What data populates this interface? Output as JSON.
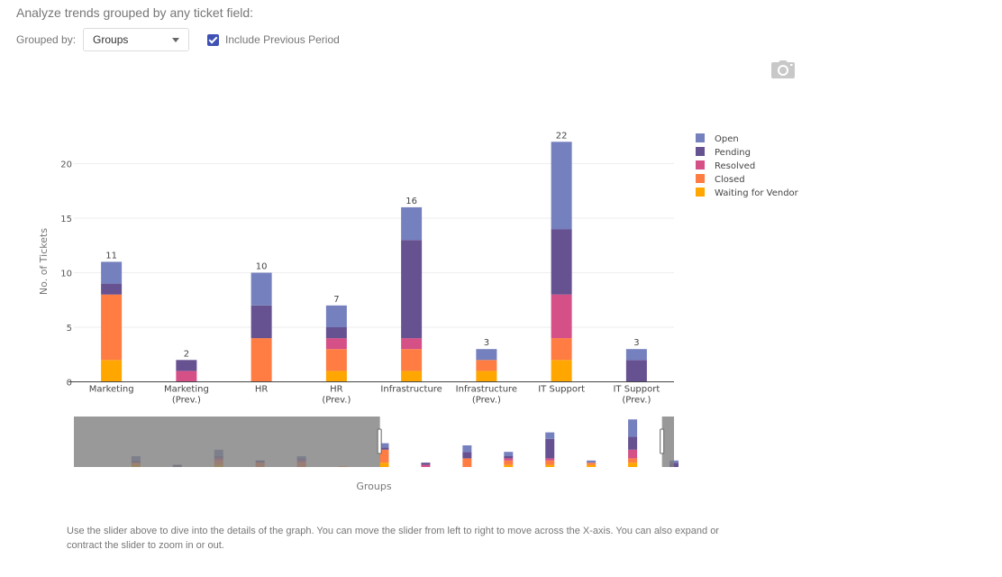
{
  "header": {
    "intro": "Analyze trends grouped by any ticket field:",
    "grouped_by_label": "Grouped by:",
    "grouped_by_value": "Groups",
    "include_previous_label": "Include Previous Period",
    "include_previous_checked": true
  },
  "toolbar": {
    "camera_icon": "camera-icon"
  },
  "note": "Use the slider above to dive into the details of the graph. You can move the slider from left to right to move across the X-axis. You can also expand or contract the slider to zoom in or out.",
  "chart_data": {
    "type": "bar",
    "stacked": true,
    "title": "",
    "xlabel": "Groups",
    "ylabel": "No. of Tickets",
    "ylim": [
      0,
      23
    ],
    "yticks": [
      0,
      5,
      10,
      15,
      20
    ],
    "grid": true,
    "legend_position": "top-right",
    "categories": [
      "Marketing",
      "Marketing (Prev.)",
      "HR",
      "HR (Prev.)",
      "Infrastructure",
      "Infrastructure (Prev.)",
      "IT Support",
      "IT Support (Prev.)"
    ],
    "category_lines": [
      [
        "Marketing"
      ],
      [
        "Marketing",
        "(Prev.)"
      ],
      [
        "HR"
      ],
      [
        "HR",
        "(Prev.)"
      ],
      [
        "Infrastructure"
      ],
      [
        "Infrastructure",
        "(Prev.)"
      ],
      [
        "IT Support"
      ],
      [
        "IT Support",
        "(Prev.)"
      ]
    ],
    "series": [
      {
        "name": "Waiting for Vendor",
        "color": "#ffa600",
        "values": [
          2,
          0,
          0,
          1,
          1,
          1,
          2,
          0
        ]
      },
      {
        "name": "Closed",
        "color": "#ff7c43",
        "values": [
          6,
          0,
          4,
          2,
          2,
          1,
          2,
          0
        ]
      },
      {
        "name": "Resolved",
        "color": "#d45087",
        "values": [
          0,
          1,
          0,
          1,
          1,
          0,
          4,
          0
        ]
      },
      {
        "name": "Pending",
        "color": "#665191",
        "values": [
          1,
          1,
          3,
          1,
          9,
          0,
          6,
          2
        ]
      },
      {
        "name": "Open",
        "color": "#7580be",
        "values": [
          2,
          0,
          3,
          2,
          3,
          1,
          8,
          1
        ]
      }
    ],
    "legend_order": [
      "Open",
      "Pending",
      "Resolved",
      "Closed",
      "Waiting for Vendor"
    ],
    "totals": [
      11,
      2,
      10,
      7,
      16,
      3,
      22,
      3
    ],
    "range_slider": {
      "hidden_categories_before": [
        {
          "values": [
            1,
            1,
            0,
            1,
            2
          ]
        },
        {
          "values": [
            0,
            0,
            0,
            1,
            0
          ]
        },
        {
          "values": [
            1,
            2,
            1,
            1,
            3
          ]
        },
        {
          "values": [
            0,
            2,
            0,
            1,
            0
          ]
        },
        {
          "values": [
            0,
            2,
            1,
            1,
            1
          ]
        },
        {
          "values": [
            0.3,
            0,
            0,
            0,
            0
          ]
        }
      ],
      "visible_start_fraction": 0.51,
      "visible_end_fraction": 0.98
    }
  }
}
